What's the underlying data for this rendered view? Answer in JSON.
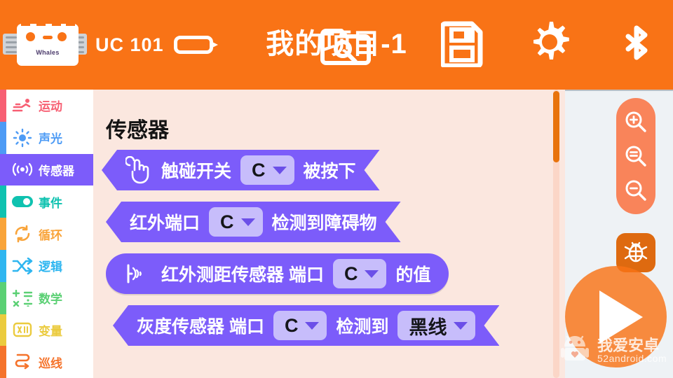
{
  "topbar": {
    "device_name": "UC 101",
    "device_logo_label": "Whales",
    "project_title": "我的项目-1",
    "battery_icon": "battery-icon",
    "open_icon": "open-folder-icon",
    "save_icon": "save-floppy-icon",
    "settings_icon": "gear-icon",
    "bluetooth_icon": "bluetooth-icon",
    "bg_color": "#F97316"
  },
  "sidebar": {
    "items": [
      {
        "label": "运动",
        "color": "#F75F73",
        "icon": "motion-icon",
        "selected": false
      },
      {
        "label": "声光",
        "color": "#4D9BF5",
        "icon": "sound-light-icon",
        "selected": false
      },
      {
        "label": "传感器",
        "color": "#7C5CFA",
        "icon": "sensor-wave-icon",
        "selected": true
      },
      {
        "label": "事件",
        "color": "#0FC2B0",
        "icon": "event-toggle-icon",
        "selected": false
      },
      {
        "label": "循环",
        "color": "#F9A43A",
        "icon": "loop-icon",
        "selected": false
      },
      {
        "label": "逻辑",
        "color": "#2FB6F0",
        "icon": "logic-shuffle-icon",
        "selected": false
      },
      {
        "label": "数学",
        "color": "#5BD074",
        "icon": "math-icon",
        "selected": false
      },
      {
        "label": "变量",
        "color": "#EBCB3E",
        "icon": "variable-icon",
        "selected": false
      },
      {
        "label": "巡线",
        "color": "#F5732B",
        "icon": "line-follow-icon",
        "selected": false
      }
    ]
  },
  "palette": {
    "title": "传感器",
    "bg_color": "#FBE7DF",
    "block_color": "#7C5CFA",
    "dropdown_color": "#C7BDFB",
    "scrollbar_color": "#E8730C",
    "blocks": [
      {
        "shape": "hex",
        "icon": "touch-hand-icon",
        "parts": [
          {
            "type": "text",
            "value": "触碰开关"
          },
          {
            "type": "dropdown",
            "value": "C"
          },
          {
            "type": "text",
            "value": "被按下"
          }
        ]
      },
      {
        "shape": "hex",
        "icon": "",
        "parts": [
          {
            "type": "text",
            "value": "红外端口"
          },
          {
            "type": "dropdown",
            "value": "C"
          },
          {
            "type": "text",
            "value": "检测到障碍物"
          }
        ]
      },
      {
        "shape": "round",
        "icon": "infrared-wave-icon",
        "parts": [
          {
            "type": "text",
            "value": "红外测距传感器 端口"
          },
          {
            "type": "dropdown",
            "value": "C"
          },
          {
            "type": "text",
            "value": "的值"
          }
        ]
      },
      {
        "shape": "hex",
        "icon": "",
        "parts": [
          {
            "type": "text",
            "value": "灰度传感器 端口"
          },
          {
            "type": "dropdown",
            "value": "C"
          },
          {
            "type": "text",
            "value": "检测到"
          },
          {
            "type": "dropdown",
            "value": "黑线"
          }
        ]
      }
    ]
  },
  "canvas": {
    "bg_color": "#eef2f5",
    "zoom_in_icon": "zoom-in-icon",
    "zoom_reset_icon": "zoom-reset-icon",
    "zoom_out_icon": "zoom-out-icon",
    "debug_icon": "bug-debug-icon",
    "run_icon": "play-run-icon"
  },
  "watermark": {
    "logo_icon": "android-robot-icon",
    "cn": "我爱安卓",
    "en": "52android.com"
  }
}
